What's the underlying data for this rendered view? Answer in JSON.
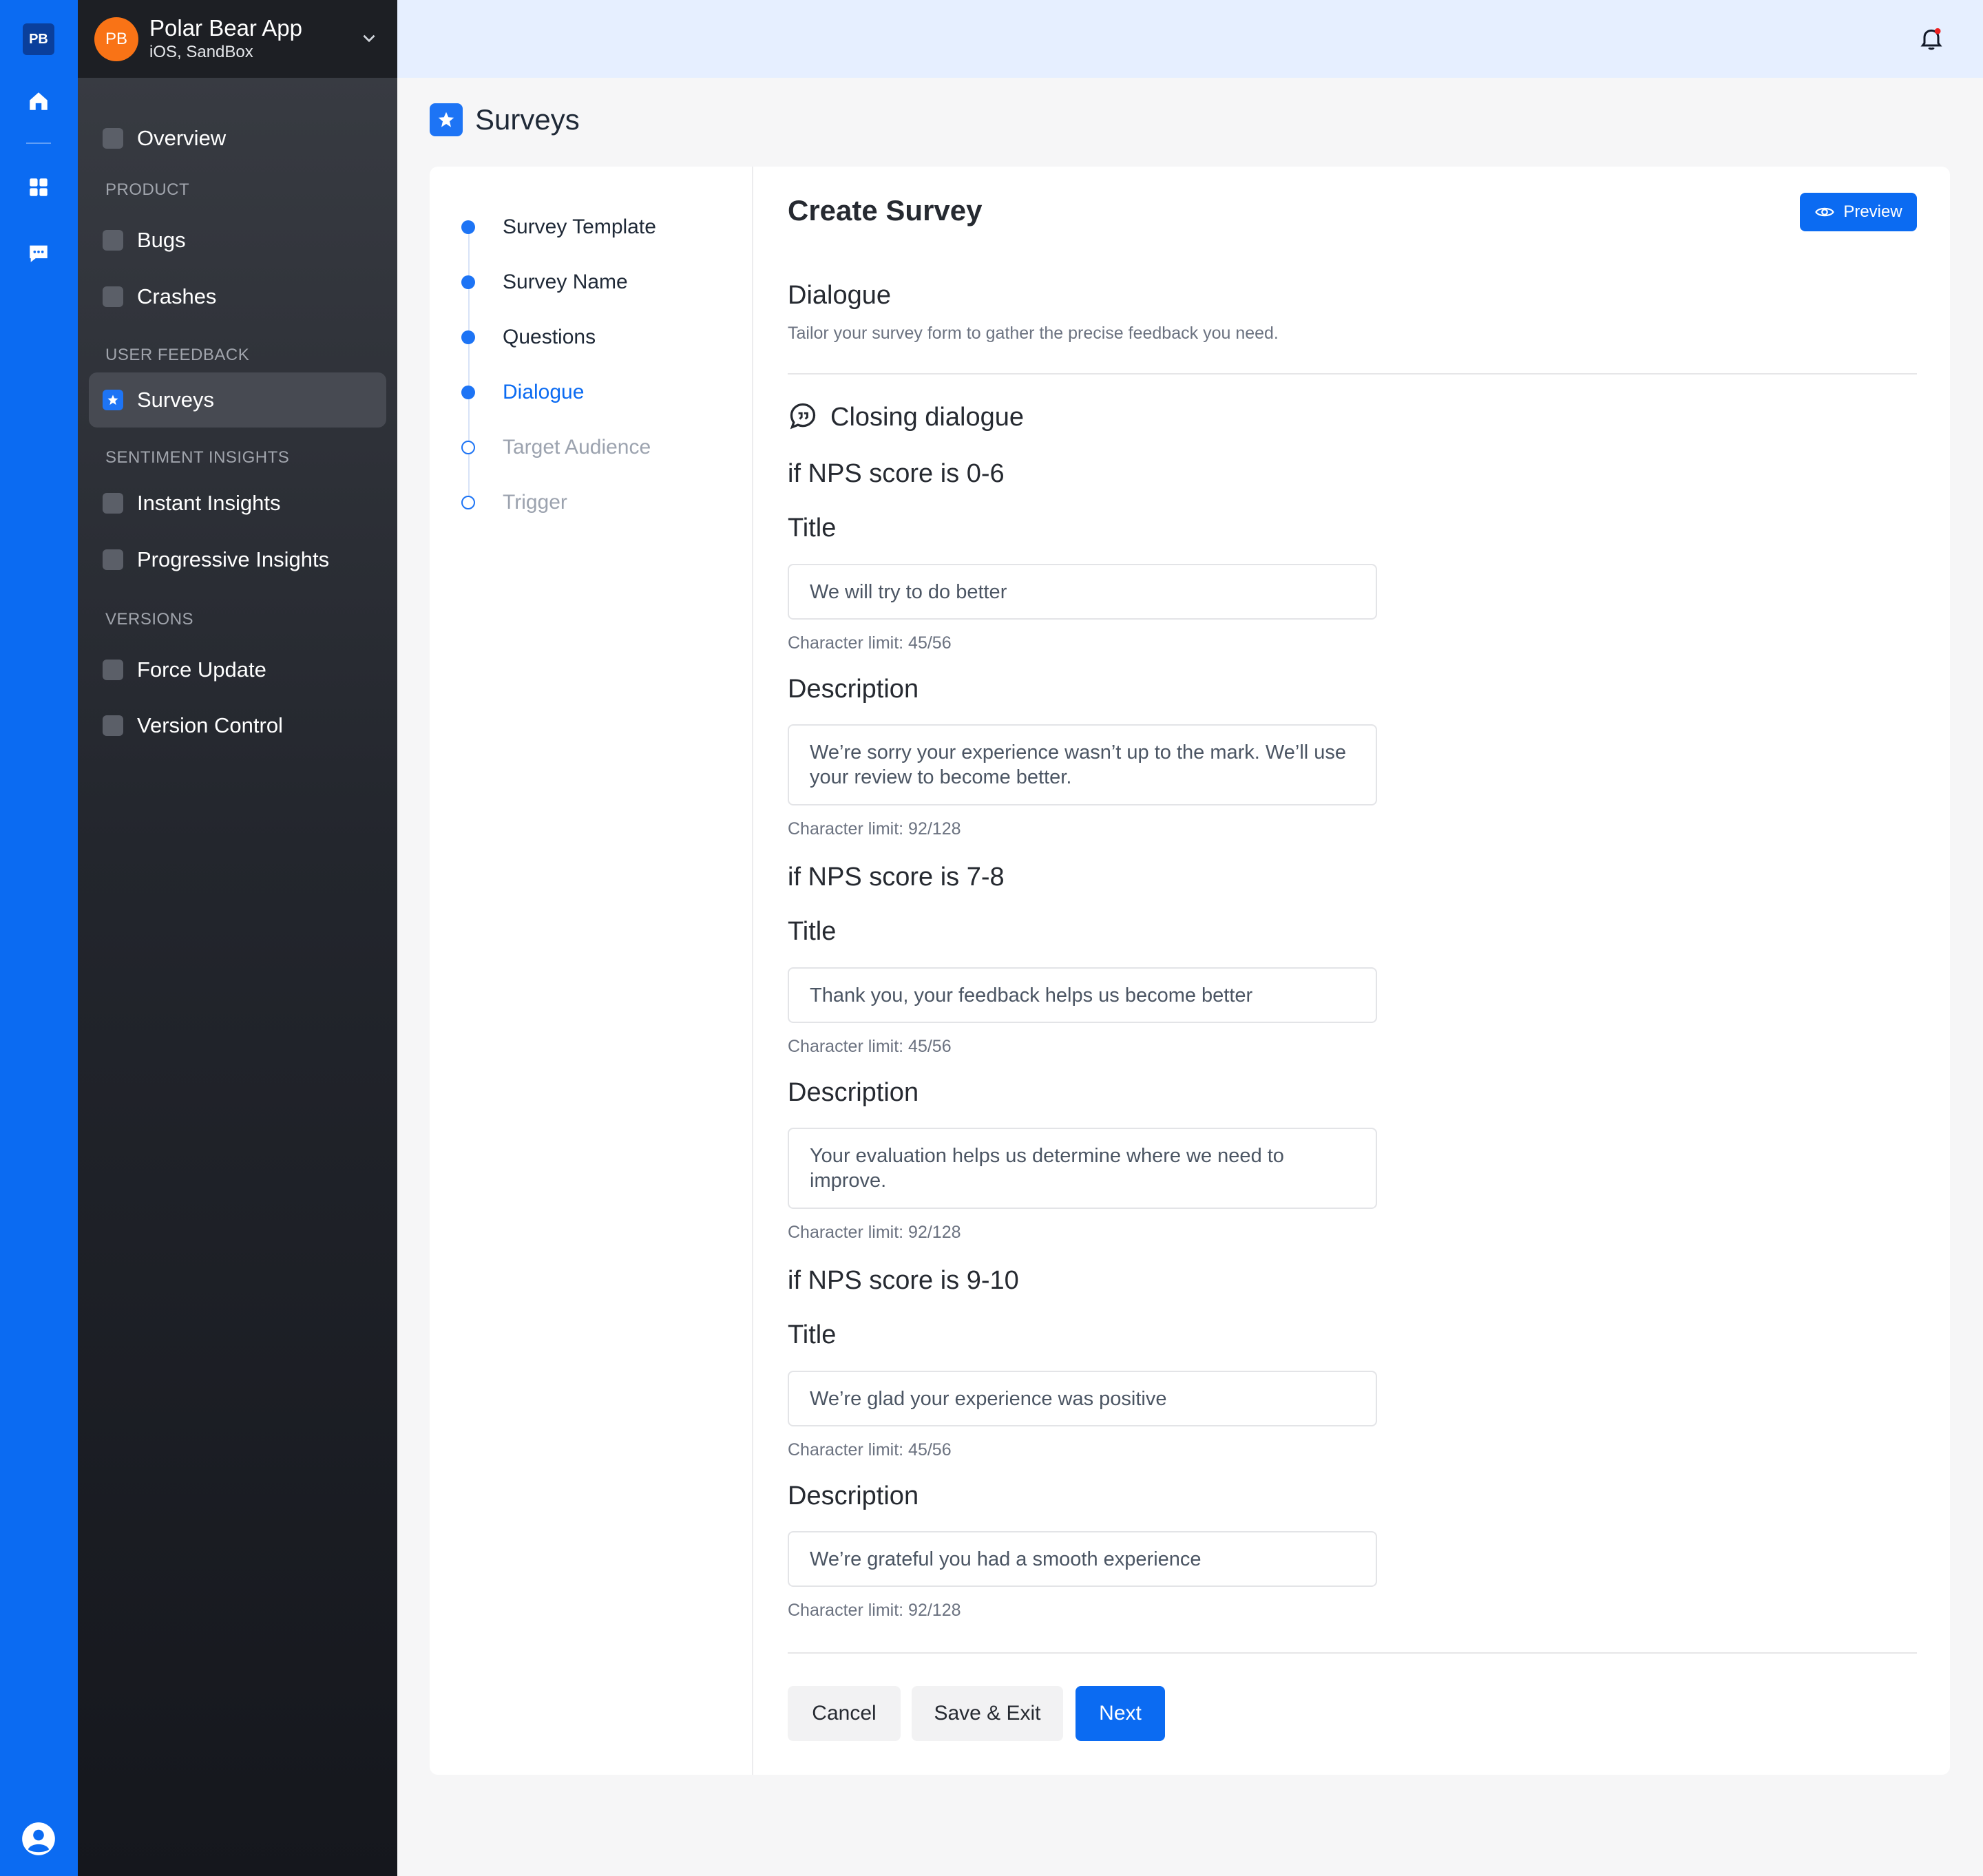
{
  "rail": {
    "badge": "PB"
  },
  "app": {
    "avatar": "PB",
    "name": "Polar Bear App",
    "platform": "iOS, SandBox"
  },
  "nav": {
    "overview": "Overview",
    "sections": {
      "product": "PRODUCT",
      "user_feedback": "USER FEEDBACK",
      "sentiment": "SENTIMENT INSIGHTS",
      "versions": "VERSIONS"
    },
    "items": {
      "bugs": "Bugs",
      "crashes": "Crashes",
      "surveys": "Surveys",
      "instant": "Instant Insights",
      "progressive": "Progressive Insights",
      "force_update": "Force Update",
      "version_control": "Version Control"
    }
  },
  "page": {
    "title": "Surveys"
  },
  "steps": [
    {
      "label": "Survey Template",
      "state": "done"
    },
    {
      "label": "Survey Name",
      "state": "done"
    },
    {
      "label": "Questions",
      "state": "done"
    },
    {
      "label": "Dialogue",
      "state": "current"
    },
    {
      "label": "Target Audience",
      "state": "pending"
    },
    {
      "label": "Trigger",
      "state": "pending"
    }
  ],
  "form": {
    "title": "Create Survey",
    "preview": "Preview",
    "section_title": "Dialogue",
    "section_sub": "Tailor your survey form to gather the precise feedback you need.",
    "closing": "Closing dialogue",
    "title_label": "Title",
    "desc_label": "Description",
    "groups": [
      {
        "heading": "if NPS score is 0-6",
        "title_value": "We will try to do better",
        "title_limit": "Character limit: 45/56",
        "desc_value": "We’re sorry your experience wasn’t up to the mark. We’ll use your review to become better.",
        "desc_limit": "Character limit: 92/128"
      },
      {
        "heading": "if NPS score is 7-8",
        "title_value": "Thank you, your feedback helps us become better",
        "title_limit": "Character limit: 45/56",
        "desc_value": "Your evaluation helps us determine where we need to improve.",
        "desc_limit": "Character limit: 92/128"
      },
      {
        "heading": "if NPS score is 9-10",
        "title_value": "We’re glad your experience was positive",
        "title_limit": "Character limit: 45/56",
        "desc_value": "We’re grateful you had a smooth experience",
        "desc_limit": "Character limit: 92/128"
      }
    ],
    "buttons": {
      "cancel": "Cancel",
      "save": "Save & Exit",
      "next": "Next"
    }
  },
  "colors": {
    "accent": "#0b6bf2",
    "rail": "#0b6bf2",
    "avatar": "#f97316"
  }
}
